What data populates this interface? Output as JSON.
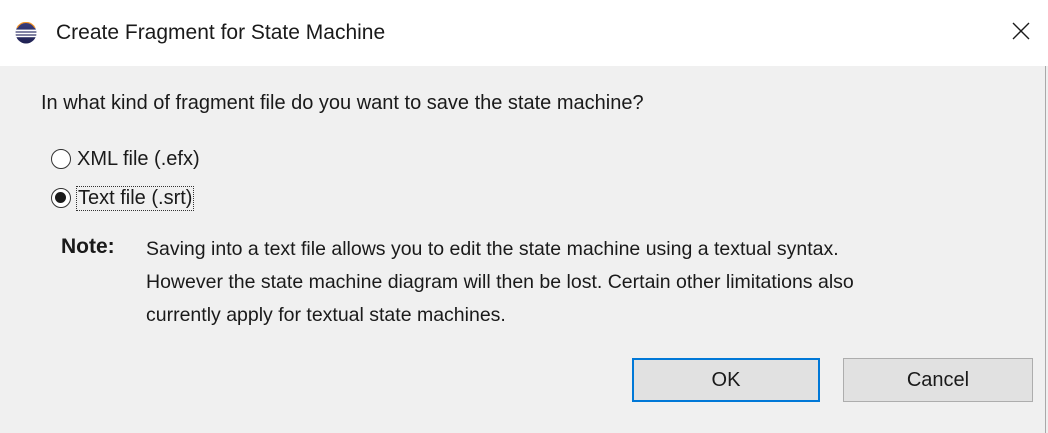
{
  "window": {
    "title": "Create Fragment for State Machine",
    "app_icon": "eclipse-icon",
    "close_icon": "close-icon"
  },
  "dialog": {
    "question": "In what kind of fragment file do you want to save the state machine?",
    "options": [
      {
        "label": "XML file (.efx)",
        "selected": false
      },
      {
        "label": "Text file (.srt)",
        "selected": true
      }
    ],
    "note_label": "Note:",
    "note_lines": [
      "Saving into a text file allows you to edit the state machine using a textual syntax.",
      "However the state machine diagram will then be lost. Certain other limitations also",
      "currently apply for textual state machines."
    ]
  },
  "buttons": {
    "ok_label": "OK",
    "cancel_label": "Cancel"
  },
  "colors": {
    "client_bg": "#f0f0f0",
    "focus_border": "#0078d7",
    "button_bg": "#e1e1e1"
  }
}
